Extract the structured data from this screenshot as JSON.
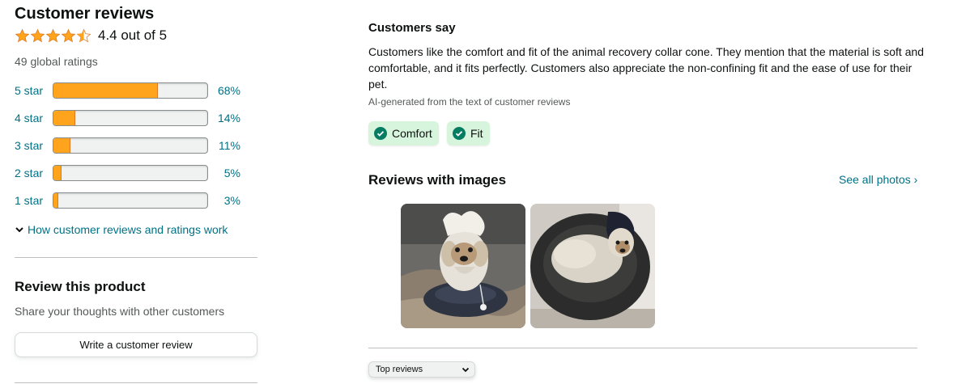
{
  "customer_reviews": {
    "title": "Customer reviews",
    "rating_value": 4.4,
    "rating_text": "4.4 out of 5",
    "global_ratings": "49 global ratings",
    "histogram": [
      {
        "label": "5 star",
        "percent_text": "68%",
        "fraction": 0.68
      },
      {
        "label": "4 star",
        "percent_text": "14%",
        "fraction": 0.14
      },
      {
        "label": "3 star",
        "percent_text": "11%",
        "fraction": 0.11
      },
      {
        "label": "2 star",
        "percent_text": "5%",
        "fraction": 0.05
      },
      {
        "label": "1 star",
        "percent_text": "3%",
        "fraction": 0.03
      }
    ],
    "how_link": "How customer reviews and ratings work"
  },
  "review_product": {
    "title": "Review this product",
    "subtitle": "Share your thoughts with other customers",
    "button_label": "Write a customer review"
  },
  "customers_say": {
    "title": "Customers say",
    "text": "Customers like the comfort and fit of the animal recovery collar cone. They mention that the material is soft and comfortable, and it fits perfectly. Customers also appreciate the non-confining fit and the ease of use for their pet.",
    "ai_note": "AI-generated from the text of customer reviews",
    "chips": [
      "Comfort",
      "Fit"
    ]
  },
  "reviews_with_images": {
    "title": "Reviews with images",
    "see_all": "See all photos ›"
  },
  "sort": {
    "selected": "Top reviews"
  },
  "colors": {
    "star": "#ffa41c",
    "link": "#007185",
    "chip_bg": "#d7f5dc",
    "check": "#067d62"
  }
}
